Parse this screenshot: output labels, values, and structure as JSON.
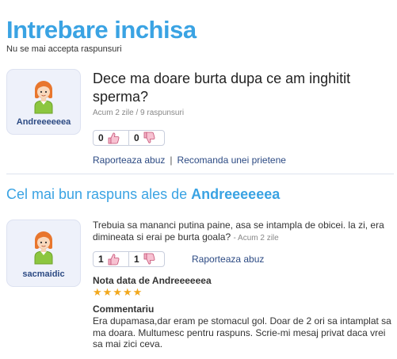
{
  "header": {
    "title": "Intrebare inchisa",
    "subtitle": "Nu se mai accepta raspunsuri"
  },
  "question": {
    "author": "Andreeeeeea",
    "text": "Dece ma doare burta dupa ce am inghitit sperma?",
    "meta": "Acum 2 zile / 9 raspunsuri",
    "votes_up": "0",
    "votes_down": "0",
    "report_link": "Raporteaza abuz",
    "separator": "|",
    "recommend_link": "Recomanda unei prietene"
  },
  "best_answer": {
    "heading_prefix": "Cel mai bun raspuns ales de",
    "heading_author": "Andreeeeeea",
    "author": "sacmaidic",
    "text": "Trebuia sa mananci putina paine, asa se intampla de obicei. la zi, era dimineata si erai pe burta goala?",
    "time": "- Acum 2 zile",
    "votes_up": "1",
    "votes_down": "1",
    "report_link": "Raporteaza abuz",
    "rating_label": "Nota data de Andreeeeeea",
    "rating": 5,
    "comment_label": "Commentariu",
    "comment": "Era dupamasa,dar eram pe stomacul gol. Doar de 2 ori sa intamplat sa ma doara. Multumesc pentru raspuns. Scrie-mi mesaj privat daca vrei sa mai zici ceva."
  },
  "colors": {
    "accent": "#3aa3e3",
    "link": "#2c4a83",
    "star": "#f2a81d"
  },
  "icons": {
    "avatar": "girl-avatar-icon",
    "thumb_up": "thumb-up-icon",
    "thumb_down": "thumb-down-icon",
    "star": "star-icon"
  }
}
